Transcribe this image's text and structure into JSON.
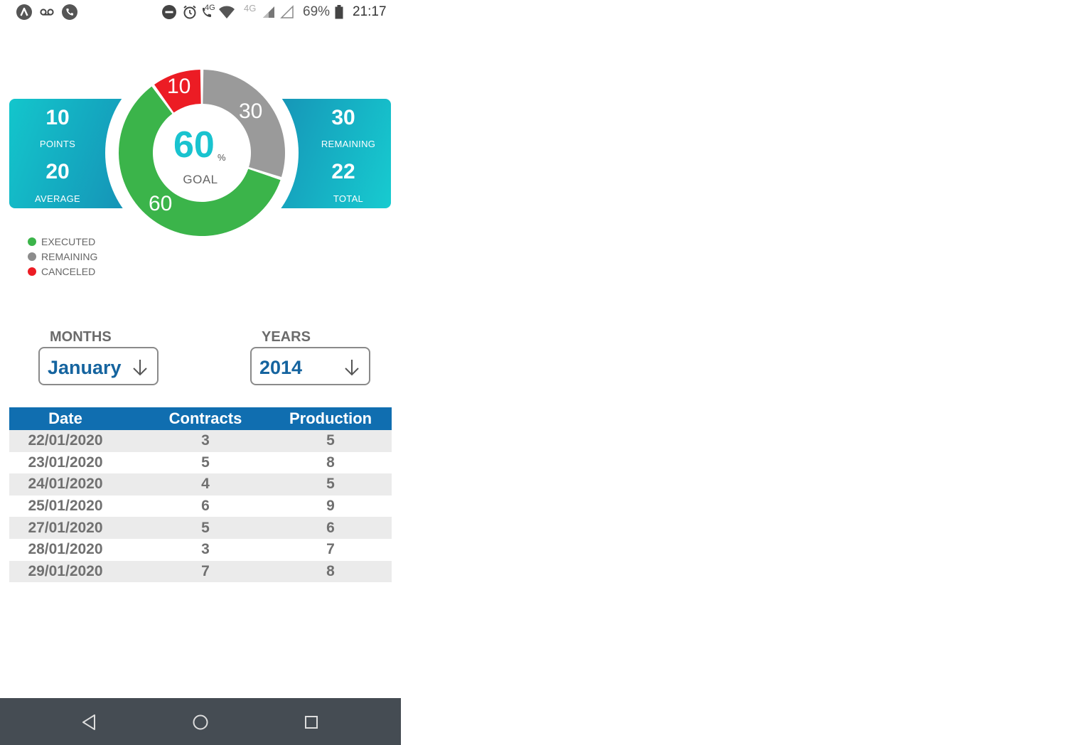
{
  "status_bar": {
    "left_icons": [
      "app-a-icon",
      "voicemail-icon",
      "phone-call-icon"
    ],
    "right_icons": [
      "do-not-disturb-icon",
      "alarm-icon",
      "call-4g-icon",
      "wifi-icon",
      "signal-icon",
      "signal-empty-icon",
      "battery-icon"
    ],
    "call_network": "4G",
    "network": "4G",
    "battery": "69%",
    "time": "21:17"
  },
  "stats": {
    "left": {
      "points_value": "10",
      "points_label": "POINTS",
      "average_value": "20",
      "average_label": "AVERAGE"
    },
    "right": {
      "remaining_value": "30",
      "remaining_label": "REMAINING",
      "total_value": "22",
      "total_label": "TOTAL"
    }
  },
  "donut": {
    "center_value": "60",
    "center_unit": "%",
    "center_label": "GOAL",
    "segments": [
      {
        "name": "EXECUTED",
        "value": 60,
        "label": "60",
        "color": "#3bb44a"
      },
      {
        "name": "REMAINING",
        "value": 30,
        "label": "30",
        "color": "#9a9a9a"
      },
      {
        "name": "CANCELED",
        "value": 10,
        "label": "10",
        "color": "#ec1c24"
      }
    ]
  },
  "legend": [
    {
      "label": "EXECUTED",
      "color": "#3bb44a"
    },
    {
      "label": "REMAINING",
      "color": "#8c8c8c"
    },
    {
      "label": "CANCELED",
      "color": "#ec1c24"
    }
  ],
  "filters": {
    "months_label": "MONTHS",
    "month_value": "January",
    "years_label": "YEARS",
    "year_value": "2014"
  },
  "table": {
    "headers": [
      "Date",
      "Contracts",
      "Production"
    ],
    "rows": [
      [
        "22/01/2020",
        "3",
        "5"
      ],
      [
        "23/01/2020",
        "5",
        "8"
      ],
      [
        "24/01/2020",
        "4",
        "5"
      ],
      [
        "25/01/2020",
        "6",
        "9"
      ],
      [
        "27/01/2020",
        "5",
        "6"
      ],
      [
        "28/01/2020",
        "3",
        "7"
      ],
      [
        "29/01/2020",
        "7",
        "8"
      ]
    ]
  },
  "nav_bar": {
    "back_icon": "back-triangle-icon",
    "home_icon": "home-circle-icon",
    "recents_icon": "recents-square-icon"
  },
  "colors": {
    "accent_teal": "#19c3cf",
    "header_blue": "#106eb0",
    "select_text": "#15649f",
    "nav_bg": "#454c53"
  }
}
